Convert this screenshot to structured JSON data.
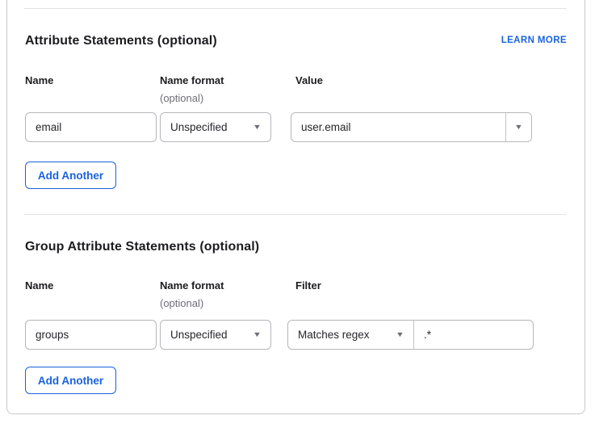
{
  "colors": {
    "accent_blue": "#1a62dc",
    "text_primary": "#1d1d21",
    "text_muted": "#6e6e78",
    "border_input": "#b6b6bd",
    "border_card": "#c9c9cf"
  },
  "icons": {
    "dropdown_arrow": "▼"
  },
  "sections": [
    {
      "title": "Attribute Statements (optional)",
      "link_label": "LEARN MORE",
      "columns": {
        "name": "Name",
        "name_format": "Name format",
        "value": "Value"
      },
      "optional_note": "(optional)",
      "row": {
        "name": "email",
        "name_format": "Unspecified",
        "value": "user.email"
      },
      "add_button_label": "Add Another"
    },
    {
      "title": "Group Attribute Statements (optional)",
      "columns": {
        "name": "Name",
        "name_format": "Name format",
        "filter": "Filter"
      },
      "optional_note": "(optional)",
      "row": {
        "name": "groups",
        "name_format": "Unspecified",
        "filter_type": "Matches regex",
        "filter_value": ".*"
      },
      "add_button_label": "Add Another"
    }
  ]
}
